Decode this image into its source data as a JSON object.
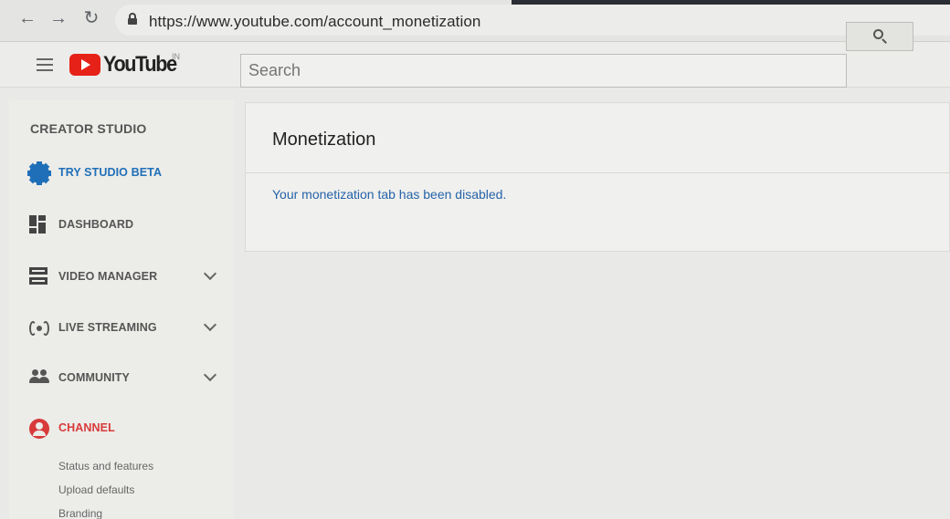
{
  "browser": {
    "url": "https://www.youtube.com/account_monetization"
  },
  "masthead": {
    "logo_text": "YouTube",
    "logo_country": "IN",
    "search_placeholder": "Search"
  },
  "sidebar": {
    "heading": "CREATOR STUDIO",
    "items": [
      {
        "label": "TRY STUDIO BETA",
        "icon": "gear-icon",
        "color": "#1f6fb8"
      },
      {
        "label": "DASHBOARD",
        "icon": "dashboard-icon"
      },
      {
        "label": "VIDEO MANAGER",
        "icon": "video-manager-icon"
      },
      {
        "label": "LIVE STREAMING",
        "icon": "live-streaming-icon"
      },
      {
        "label": "COMMUNITY",
        "icon": "community-icon"
      },
      {
        "label": "CHANNEL",
        "icon": "channel-icon",
        "color": "#d83a3a"
      }
    ],
    "channel_subitems": [
      "Status and features",
      "Upload defaults",
      "Branding"
    ]
  },
  "main": {
    "title": "Monetization",
    "message": "Your monetization tab has been disabled."
  },
  "colors": {
    "brand_red": "#e62117",
    "link_blue": "#2563a8"
  }
}
